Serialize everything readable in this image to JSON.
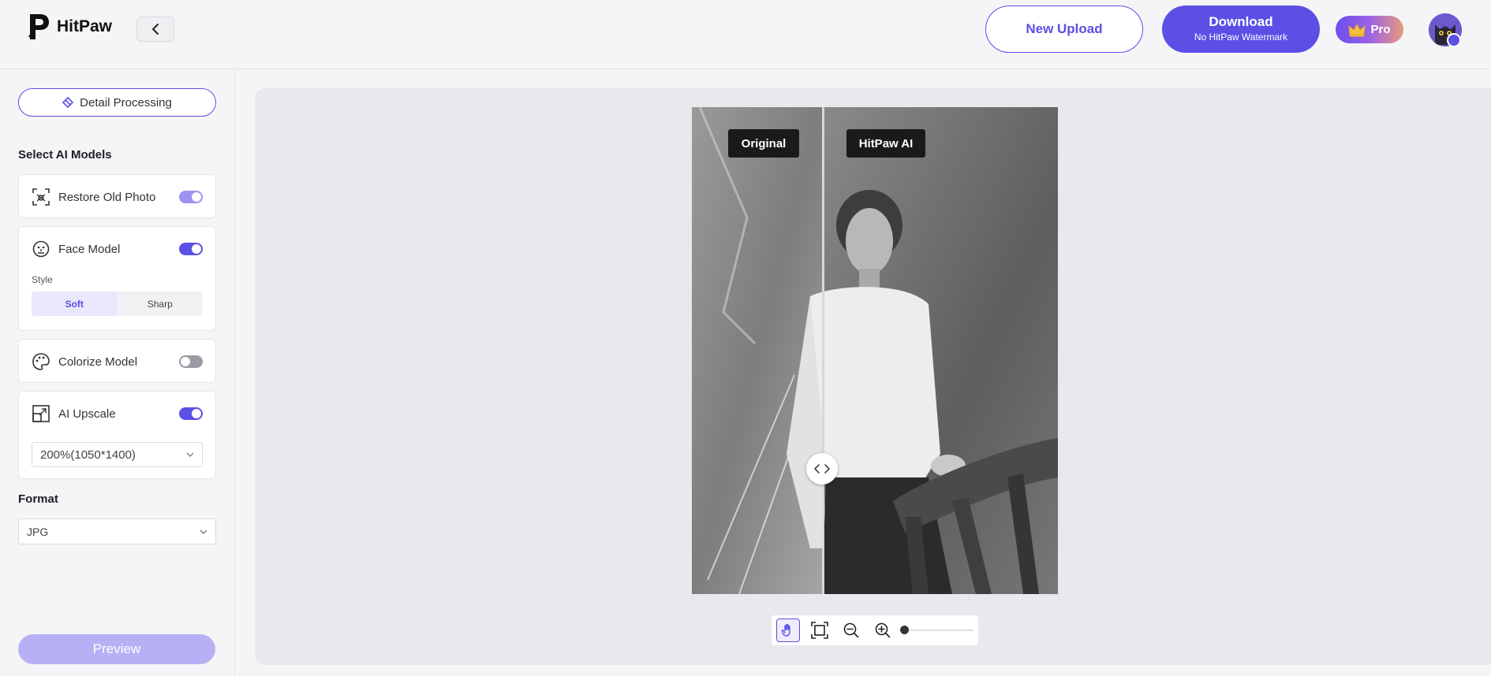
{
  "app": {
    "name": "HitPaw"
  },
  "header": {
    "new_upload_label": "New Upload",
    "download_title": "Download",
    "download_subtitle": "No HitPaw Watermark",
    "pro_label": "Pro"
  },
  "sidebar": {
    "detail_processing_label": "Detail Processing",
    "select_models_title": "Select AI Models",
    "models": [
      {
        "label": "Restore Old Photo",
        "icon": "restore-photo-icon",
        "enabled": true
      },
      {
        "label": "Face Model",
        "icon": "face-icon",
        "enabled": true
      },
      {
        "label": "Colorize Model",
        "icon": "palette-icon",
        "enabled": false
      },
      {
        "label": "AI Upscale",
        "icon": "upscale-icon",
        "enabled": true
      }
    ],
    "face_style": {
      "label": "Style",
      "options": [
        "Soft",
        "Sharp"
      ],
      "selected": "Soft"
    },
    "upscale_value": "200%(1050*1400)",
    "format_title": "Format",
    "format_value": "JPG",
    "preview_label": "Preview"
  },
  "canvas": {
    "original_tag": "Original",
    "ai_tag": "HitPaw AI",
    "split_position": 0.36
  },
  "toolbar": {
    "tools": [
      "hand-icon",
      "fit-screen-icon",
      "zoom-out-icon",
      "zoom-in-icon"
    ],
    "active_tool": "hand-icon",
    "zoom_level": 0
  },
  "colors": {
    "accent": "#5b4fe6",
    "accent_light": "#b8b0f5",
    "canvas_bg": "#e8e8ed"
  }
}
